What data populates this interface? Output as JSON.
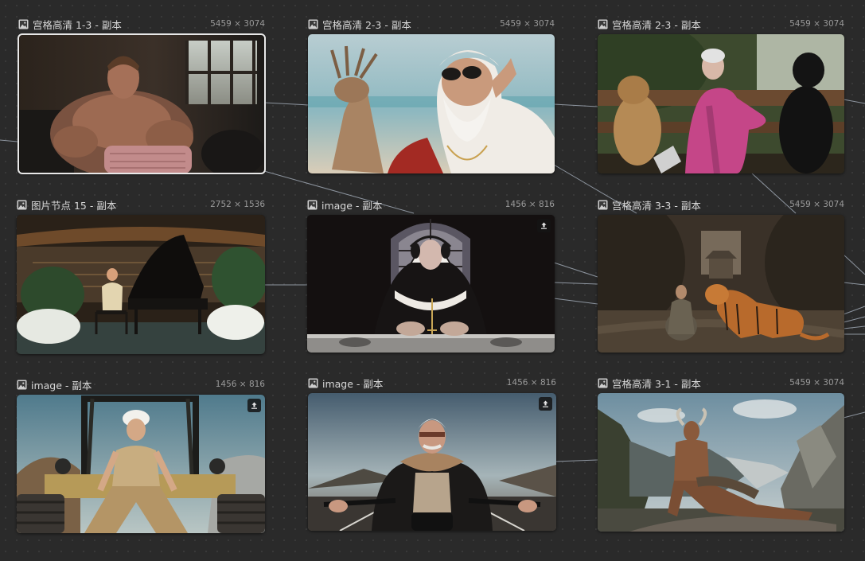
{
  "canvas": {
    "background": "#2a2a2a",
    "wire_color": "#9fa8b4"
  },
  "nodes": [
    {
      "title": "宫格高清 1-3 - 副本",
      "dims": "5459 × 3074",
      "icon": "image-icon",
      "selected": true,
      "upload": false,
      "scene": "knitting-bodybuilder"
    },
    {
      "title": "宫格高清 2-3 - 副本",
      "dims": "5459 × 3074",
      "icon": "image-icon",
      "selected": false,
      "upload": false,
      "scene": "santa-with-deer"
    },
    {
      "title": "宫格高清 2-3 - 副本",
      "dims": "5459 × 3074",
      "icon": "image-icon",
      "selected": false,
      "upload": false,
      "scene": "grandma-with-dogs"
    },
    {
      "title": "图片节点 15 - 副本",
      "dims": "2752 × 1536",
      "icon": "image-icon",
      "selected": false,
      "upload": false,
      "scene": "piano-lounge"
    },
    {
      "title": "image - 副本",
      "dims": "1456 × 816",
      "icon": "image-icon",
      "selected": false,
      "upload": true,
      "scene": "nun-dj"
    },
    {
      "title": "宫格高清 3-3 - 副本",
      "dims": "5459 × 3074",
      "icon": "image-icon",
      "selected": false,
      "upload": false,
      "scene": "monk-and-tiger"
    },
    {
      "title": "image - 副本",
      "dims": "1456 × 816",
      "icon": "image-icon",
      "selected": false,
      "upload": true,
      "scene": "tractor-worker"
    },
    {
      "title": "image - 副本",
      "dims": "1456 × 816",
      "icon": "image-icon",
      "selected": false,
      "upload": true,
      "scene": "grandpa-biker"
    },
    {
      "title": "宫格高清 3-1 - 副本",
      "dims": "5459 × 3074",
      "icon": "image-icon",
      "selected": false,
      "upload": false,
      "scene": "horned-warrior-mountains"
    }
  ]
}
